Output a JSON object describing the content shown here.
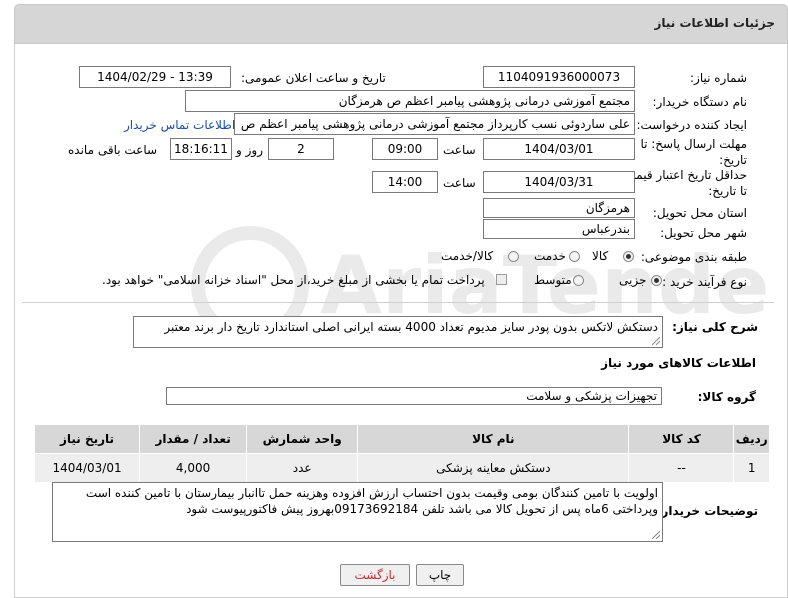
{
  "header": {
    "title": "جزئیات اطلاعات نیاز"
  },
  "form": {
    "need_number_label": "شماره نیاز:",
    "need_number": "1104091936000073",
    "announce_label": "تاریخ و ساعت اعلان عمومی:",
    "announce_value": "1404/02/29 - 13:39",
    "buyer_org_label": "نام دستگاه خریدار:",
    "buyer_org": "مجتمع آموزشی درمانی پژوهشی پیامبر اعظم ص  هرمزگان",
    "requester_label": "ایجاد کننده درخواست:",
    "requester": "علی ساردوئی نسب کارپرداز مجتمع آموزشی درمانی پژوهشی پیامبر اعظم ص",
    "contact_link": "اطلاعات تماس خریدار",
    "reply_deadline_label_1": "مهلت ارسال پاسخ: تا",
    "reply_deadline_label_2": "تاریخ:",
    "reply_date": "1404/03/01",
    "time_label": "ساعت",
    "reply_time": "09:00",
    "days_value": "2",
    "days_label": "روز و",
    "remaining_time": "18:16:11",
    "remaining_label": "ساعت باقی مانده",
    "price_deadline_label_1": "حداقل تاریخ اعتبار قیمت:",
    "price_deadline_label_2": "تا تاریخ:",
    "price_date": "1404/03/31",
    "price_time_label": "ساعت",
    "price_time": "14:00",
    "province_label": "استان محل تحویل:",
    "province": "هرمزگان",
    "city_label": "شهر محل تحویل:",
    "city": "بندرعباس",
    "category_label": "طبقه بندی موضوعی:",
    "category_options": [
      "کالا",
      "خدمت",
      "کالا/خدمت"
    ],
    "category_selected": "کالا",
    "process_label": "نوع فرآیند خرید :",
    "process_options": [
      "جزیی",
      "متوسط"
    ],
    "process_selected": "جزیی",
    "payment_note": "پرداخت تمام یا بخشی از مبلغ خرید،از محل \"اسناد خزانه اسلامی\" خواهد بود."
  },
  "description": {
    "label": "شرح کلی نیاز:",
    "text": "دستکش لاتکس بدون پودر سایز مدیوم تعداد 4000 بسته  ایرانی  اصلی  استاندارد  تاریخ  دار  برند  معتبر"
  },
  "goods_info": {
    "title": "اطلاعات کالاهای مورد نیاز",
    "group_label": "گروه کالا:",
    "group_value": "تجهیزات پزشکی و سلامت"
  },
  "table": {
    "headers": [
      "ردیف",
      "کد کالا",
      "نام کالا",
      "واحد شمارش",
      "تعداد / مقدار",
      "تاریخ نیاز"
    ],
    "rows": [
      [
        "1",
        "--",
        "دستکش معاینه پزشکی",
        "عدد",
        "4,000",
        "1404/03/01"
      ]
    ]
  },
  "buyer_notes": {
    "label": "توضیحات خریدار:",
    "text": "اولویت با تامین کنندگان بومی وقیمت بدون احتساب ارزش افزوده وهزینه حمل تاانبار بیمارستان با تامین کننده است وپرداختی 6ماه پس از تحویل کالا می باشد تلفن 09173692184بهروز پیش فاکتورپیوست شود"
  },
  "buttons": {
    "print": "چاپ",
    "back": "بازگشت"
  },
  "colors": {
    "header_bg": "#d6d6d6",
    "link": "#1a4fa0",
    "back_button_text": "#c03030"
  },
  "watermark": {
    "text": "AriaTender.net"
  }
}
